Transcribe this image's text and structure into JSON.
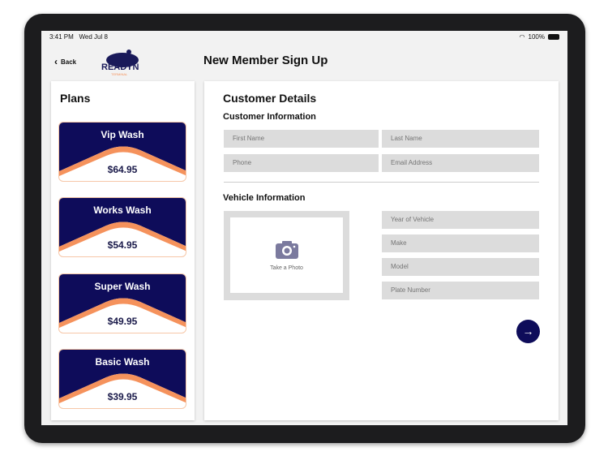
{
  "status": {
    "time": "3:41 PM",
    "date": "Wed Jul 8",
    "battery": "100%"
  },
  "header": {
    "back_label": "Back",
    "logo_text": "READYN",
    "logo_sub": "TERMINAL",
    "title": "New Member Sign Up"
  },
  "plans": {
    "title": "Plans",
    "items": [
      {
        "name": "Vip Wash",
        "price": "$64.95"
      },
      {
        "name": "Works Wash",
        "price": "$54.95"
      },
      {
        "name": "Super Wash",
        "price": "$49.95"
      },
      {
        "name": "Basic Wash",
        "price": "$39.95"
      }
    ]
  },
  "customer": {
    "title": "Customer Details",
    "info_heading": "Customer Information",
    "first_name": "First Name",
    "last_name": "Last Name",
    "phone": "Phone",
    "email": "Email Address"
  },
  "vehicle": {
    "heading": "Vehicle Information",
    "photo_label": "Take a Photo",
    "year": "Year of Vehicle",
    "make": "Make",
    "model": "Model",
    "plate": "Plate Number"
  },
  "colors": {
    "navy": "#0e0c5a",
    "orange": "#f5925c",
    "field": "#dcdcdc"
  }
}
